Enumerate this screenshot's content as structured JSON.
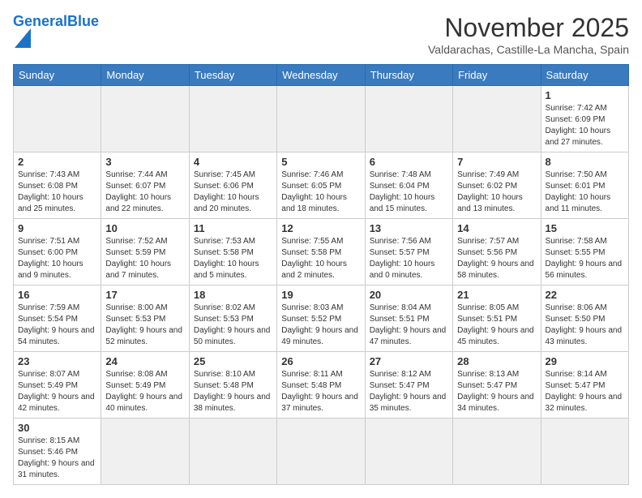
{
  "header": {
    "logo_general": "General",
    "logo_blue": "Blue",
    "title": "November 2025",
    "subtitle": "Valdarachas, Castille-La Mancha, Spain"
  },
  "weekdays": [
    "Sunday",
    "Monday",
    "Tuesday",
    "Wednesday",
    "Thursday",
    "Friday",
    "Saturday"
  ],
  "weeks": [
    [
      {
        "day": "",
        "info": ""
      },
      {
        "day": "",
        "info": ""
      },
      {
        "day": "",
        "info": ""
      },
      {
        "day": "",
        "info": ""
      },
      {
        "day": "",
        "info": ""
      },
      {
        "day": "",
        "info": ""
      },
      {
        "day": "1",
        "info": "Sunrise: 7:42 AM\nSunset: 6:09 PM\nDaylight: 10 hours and 27 minutes."
      }
    ],
    [
      {
        "day": "2",
        "info": "Sunrise: 7:43 AM\nSunset: 6:08 PM\nDaylight: 10 hours and 25 minutes."
      },
      {
        "day": "3",
        "info": "Sunrise: 7:44 AM\nSunset: 6:07 PM\nDaylight: 10 hours and 22 minutes."
      },
      {
        "day": "4",
        "info": "Sunrise: 7:45 AM\nSunset: 6:06 PM\nDaylight: 10 hours and 20 minutes."
      },
      {
        "day": "5",
        "info": "Sunrise: 7:46 AM\nSunset: 6:05 PM\nDaylight: 10 hours and 18 minutes."
      },
      {
        "day": "6",
        "info": "Sunrise: 7:48 AM\nSunset: 6:04 PM\nDaylight: 10 hours and 15 minutes."
      },
      {
        "day": "7",
        "info": "Sunrise: 7:49 AM\nSunset: 6:02 PM\nDaylight: 10 hours and 13 minutes."
      },
      {
        "day": "8",
        "info": "Sunrise: 7:50 AM\nSunset: 6:01 PM\nDaylight: 10 hours and 11 minutes."
      }
    ],
    [
      {
        "day": "9",
        "info": "Sunrise: 7:51 AM\nSunset: 6:00 PM\nDaylight: 10 hours and 9 minutes."
      },
      {
        "day": "10",
        "info": "Sunrise: 7:52 AM\nSunset: 5:59 PM\nDaylight: 10 hours and 7 minutes."
      },
      {
        "day": "11",
        "info": "Sunrise: 7:53 AM\nSunset: 5:58 PM\nDaylight: 10 hours and 5 minutes."
      },
      {
        "day": "12",
        "info": "Sunrise: 7:55 AM\nSunset: 5:58 PM\nDaylight: 10 hours and 2 minutes."
      },
      {
        "day": "13",
        "info": "Sunrise: 7:56 AM\nSunset: 5:57 PM\nDaylight: 10 hours and 0 minutes."
      },
      {
        "day": "14",
        "info": "Sunrise: 7:57 AM\nSunset: 5:56 PM\nDaylight: 9 hours and 58 minutes."
      },
      {
        "day": "15",
        "info": "Sunrise: 7:58 AM\nSunset: 5:55 PM\nDaylight: 9 hours and 56 minutes."
      }
    ],
    [
      {
        "day": "16",
        "info": "Sunrise: 7:59 AM\nSunset: 5:54 PM\nDaylight: 9 hours and 54 minutes."
      },
      {
        "day": "17",
        "info": "Sunrise: 8:00 AM\nSunset: 5:53 PM\nDaylight: 9 hours and 52 minutes."
      },
      {
        "day": "18",
        "info": "Sunrise: 8:02 AM\nSunset: 5:53 PM\nDaylight: 9 hours and 50 minutes."
      },
      {
        "day": "19",
        "info": "Sunrise: 8:03 AM\nSunset: 5:52 PM\nDaylight: 9 hours and 49 minutes."
      },
      {
        "day": "20",
        "info": "Sunrise: 8:04 AM\nSunset: 5:51 PM\nDaylight: 9 hours and 47 minutes."
      },
      {
        "day": "21",
        "info": "Sunrise: 8:05 AM\nSunset: 5:51 PM\nDaylight: 9 hours and 45 minutes."
      },
      {
        "day": "22",
        "info": "Sunrise: 8:06 AM\nSunset: 5:50 PM\nDaylight: 9 hours and 43 minutes."
      }
    ],
    [
      {
        "day": "23",
        "info": "Sunrise: 8:07 AM\nSunset: 5:49 PM\nDaylight: 9 hours and 42 minutes."
      },
      {
        "day": "24",
        "info": "Sunrise: 8:08 AM\nSunset: 5:49 PM\nDaylight: 9 hours and 40 minutes."
      },
      {
        "day": "25",
        "info": "Sunrise: 8:10 AM\nSunset: 5:48 PM\nDaylight: 9 hours and 38 minutes."
      },
      {
        "day": "26",
        "info": "Sunrise: 8:11 AM\nSunset: 5:48 PM\nDaylight: 9 hours and 37 minutes."
      },
      {
        "day": "27",
        "info": "Sunrise: 8:12 AM\nSunset: 5:47 PM\nDaylight: 9 hours and 35 minutes."
      },
      {
        "day": "28",
        "info": "Sunrise: 8:13 AM\nSunset: 5:47 PM\nDaylight: 9 hours and 34 minutes."
      },
      {
        "day": "29",
        "info": "Sunrise: 8:14 AM\nSunset: 5:47 PM\nDaylight: 9 hours and 32 minutes."
      }
    ],
    [
      {
        "day": "30",
        "info": "Sunrise: 8:15 AM\nSunset: 5:46 PM\nDaylight: 9 hours and 31 minutes."
      },
      {
        "day": "",
        "info": ""
      },
      {
        "day": "",
        "info": ""
      },
      {
        "day": "",
        "info": ""
      },
      {
        "day": "",
        "info": ""
      },
      {
        "day": "",
        "info": ""
      },
      {
        "day": "",
        "info": ""
      }
    ]
  ]
}
